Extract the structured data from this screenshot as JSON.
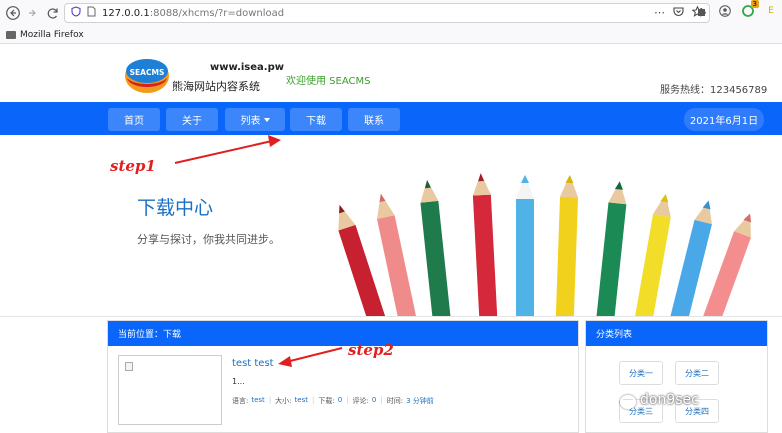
{
  "browser": {
    "url_host": "127.0.0.1",
    "url_rest": ":8088/xhcms/?r=download",
    "bookmark": "Mozilla Firefox",
    "ext_badge": "3",
    "more_icon": "⋯"
  },
  "header": {
    "logo_text": "SEACMS",
    "site_url": "www.isea.pw",
    "site_name": "熊海网站内容系统",
    "welcome": "欢迎使用 SEACMS",
    "hotline": "服务热线：123456789"
  },
  "nav": {
    "items": [
      "首页",
      "关于",
      "列表",
      "下载",
      "联系"
    ],
    "date": "2021年6月1日"
  },
  "hero": {
    "title": "下载中心",
    "subtitle": "分享与探讨，你我共同进步。"
  },
  "annotations": {
    "step1": "step1",
    "step2": "step2"
  },
  "content": {
    "breadcrumb": "当前位置：下载",
    "item": {
      "title": "test test",
      "desc": "1...",
      "lang_label": "语言:",
      "lang": "test",
      "size_label": "大小:",
      "size": "test",
      "downloads_label": "下载:",
      "downloads": "0",
      "comments_label": "评论:",
      "comments": "0",
      "time_label": "时间:",
      "time": "3 分钟前"
    }
  },
  "sidebar": {
    "title": "分类列表",
    "categories": [
      "分类一",
      "分类二",
      "分类三",
      "分类四"
    ]
  },
  "watermark": "don9sec",
  "colors": {
    "nav_blue": "#0a66fa",
    "link_blue": "#1a6fc4",
    "welcome_green": "#3aa02a",
    "annotation_red": "#e02020"
  }
}
